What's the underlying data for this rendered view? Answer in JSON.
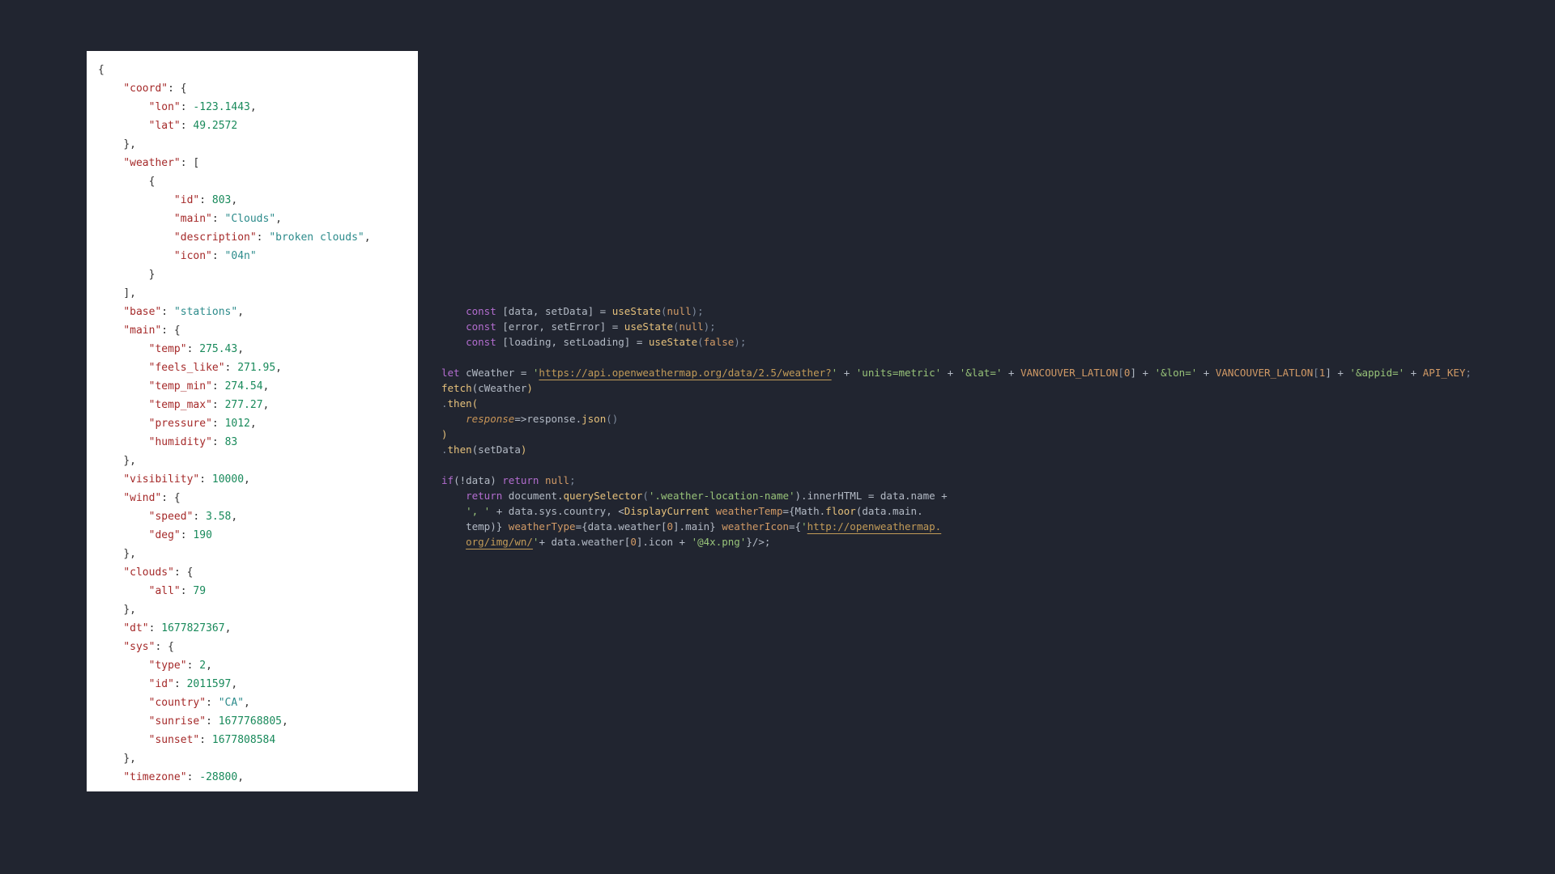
{
  "json_panel": {
    "coord_key": "\"coord\"",
    "lon_key": "\"lon\"",
    "lon_val": "-123.1443",
    "lat_key": "\"lat\"",
    "lat_val": "49.2572",
    "weather_key": "\"weather\"",
    "id_key": "\"id\"",
    "id_val": "803",
    "main_key": "\"main\"",
    "main_val": "\"Clouds\"",
    "desc_key": "\"description\"",
    "desc_val": "\"broken clouds\"",
    "icon_key": "\"icon\"",
    "icon_val": "\"04n\"",
    "base_key": "\"base\"",
    "base_val": "\"stations\"",
    "main2_key": "\"main\"",
    "temp_key": "\"temp\"",
    "temp_val": "275.43",
    "feels_key": "\"feels_like\"",
    "feels_val": "271.95",
    "tmin_key": "\"temp_min\"",
    "tmin_val": "274.54",
    "tmax_key": "\"temp_max\"",
    "tmax_val": "277.27",
    "press_key": "\"pressure\"",
    "press_val": "1012",
    "hum_key": "\"humidity\"",
    "hum_val": "83",
    "vis_key": "\"visibility\"",
    "vis_val": "10000",
    "wind_key": "\"wind\"",
    "speed_key": "\"speed\"",
    "speed_val": "3.58",
    "deg_key": "\"deg\"",
    "deg_val": "190",
    "clouds_key": "\"clouds\"",
    "all_key": "\"all\"",
    "all_val": "79",
    "dt_key": "\"dt\"",
    "dt_val": "1677827367",
    "sys_key": "\"sys\"",
    "type_key": "\"type\"",
    "type_val": "2",
    "sid_key": "\"id\"",
    "sid_val": "2011597",
    "country_key": "\"country\"",
    "country_val": "\"CA\"",
    "sunrise_key": "\"sunrise\"",
    "sunrise_val": "1677768805",
    "sunset_key": "\"sunset\"",
    "sunset_val": "1677808584",
    "tz_key": "\"timezone\"",
    "tz_val": "-28800"
  },
  "code_panel": {
    "l1a": "const",
    "l1b": " [data, setData] = ",
    "l1c": "useState",
    "l1d": "(",
    "l1e": "null",
    "l1f": ");",
    "l2a": "const",
    "l2b": " [error, setError] = ",
    "l2c": "useState",
    "l2d": "(",
    "l2e": "null",
    "l2f": ");",
    "l3a": "const",
    "l3b": " [loading, setLoading] = ",
    "l3c": "useState",
    "l3d": "(",
    "l3e": "false",
    "l3f": ");",
    "l5a": "let",
    "l5b": " cWeather = ",
    "l5c": "'",
    "l5d": "https://api.openweathermap.org/data/2.5/weather?",
    "l5e": "'",
    "l5f": " + ",
    "l5g": "'units=metric'",
    "l5h": " + ",
    "l5i": "'&lat='",
    "l5j": " + ",
    "l5k": "VANCOUVER_LATLON",
    "l5l": "[",
    "l5m": "0",
    "l5n": "] + ",
    "l5o": "'&lon='",
    "l5p": " + ",
    "l5q": "VANCOUVER_LATLON",
    "l5r": "[",
    "l5s": "1",
    "l5t": "] + ",
    "l5u": "'&appid='",
    "l5v": " + ",
    "l5w": "API_KEY",
    "l5x": ";",
    "l6a": "fetch",
    "l6b": "(cWeather",
    ")": "",
    "l6c": ")",
    "l7a": ".",
    "l7b": "then",
    "l7c": "(",
    "l8a": "response",
    "l8b": "=>response.",
    "l8c": "json",
    "l8d": "()",
    "l9": ")",
    "l10a": ".",
    "l10b": "then",
    "l10c": "(setData",
    ")a": "",
    "l10d": ")",
    "l12a": "if",
    "l12b": "(!data) ",
    "l12c": "return",
    "l12d": " ",
    "l12e": "null",
    "l12f": ";",
    "l13a": "return",
    "l13b": " document.",
    "l13c": "querySelector",
    "l13d": "(",
    "l13e": "'.weather-location-name'",
    "l13f": ").innerHTML = data.name +",
    "l14a": "', '",
    "l14b": " + data.sys.country, <",
    "l14c": "DisplayCurrent",
    "l14d": " ",
    "l14e": "weatherTemp",
    "l14f": "={Math.",
    "l14g": "floor",
    "l14h": "(data.main.",
    "l15a": "temp)} ",
    "l15b": "weatherType",
    "l15c": "={data.weather[",
    "l15d": "0",
    "l15e": "].main} ",
    "l15f": "weatherIcon",
    "l15g": "={",
    "l15h": "'",
    "l15i": "http://openweathermap.",
    "l16a": "org/img/wn/",
    "l16b": "'",
    "l16c": "+ data.weather[",
    "l16d": "0",
    "l16e": "].icon + ",
    "l16f": "'@4x.png'",
    "l16g": "}/>;"
  }
}
